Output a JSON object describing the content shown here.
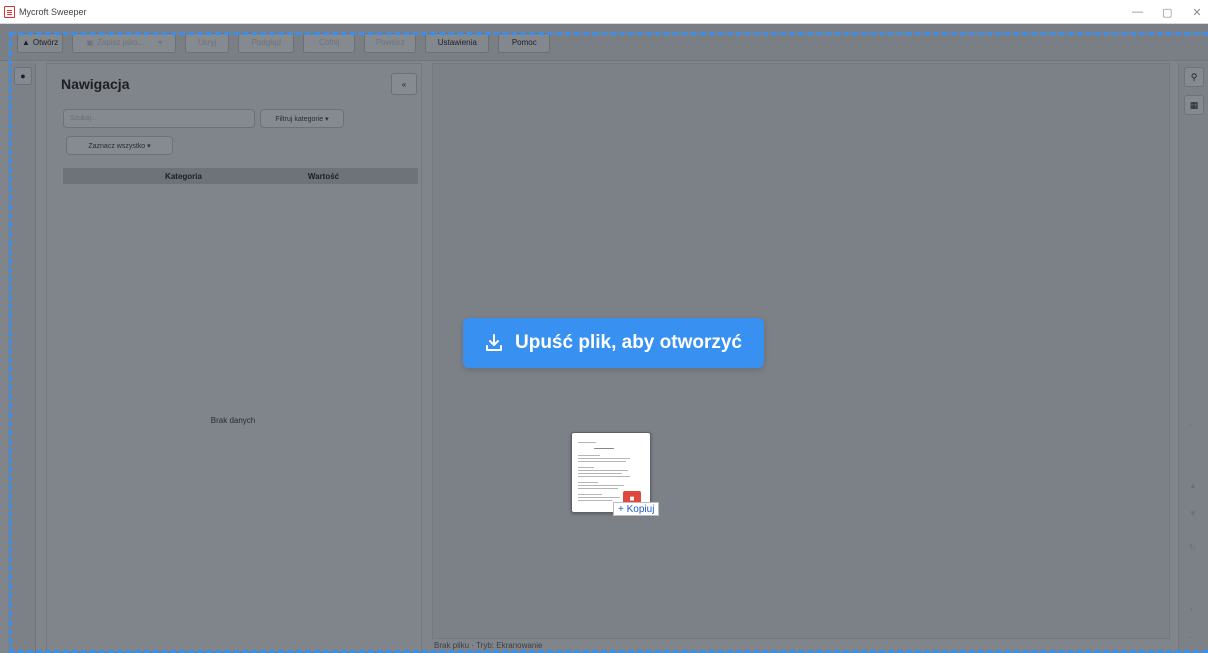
{
  "window": {
    "title": "Mycroft Sweeper",
    "controls": {
      "minimize": "—",
      "maximize": "▢",
      "close": "✕"
    }
  },
  "toolbar": {
    "open_label": "Otwórz",
    "save_as_label": "Zapisz jako...",
    "save_as_dropdown": "▾",
    "hide_label": "Ukryj",
    "preview_label": "Podgląd",
    "undo_label": "Cofnij",
    "redo_label": "Powtórz",
    "settings_label": "Ustawienia",
    "help_label": "Pomoc"
  },
  "nav": {
    "title": "Nawigacja",
    "collapse_icon": "«",
    "search_placeholder": "Szukaj...",
    "filter_label": "Filtruj kategorie ▾",
    "select_all_label": "Zaznacz wszystko ▾",
    "columns": [
      "Kategoria",
      "Wartość"
    ],
    "empty_message": "Brak danych"
  },
  "viewer": {
    "status_text": "Brak pliku · Tryb: Ekranowanie"
  },
  "drop": {
    "message": "Upuść plik, aby otworzyć",
    "copy_tooltip": "+ Kopiuj"
  },
  "colors": {
    "accent": "#3890f0",
    "dashed_outline": "#3b8fe8",
    "pdf_badge": "#e0483e",
    "overlay_background": "#80858b"
  },
  "icons": {
    "open": "folder-icon",
    "save_as": "save-icon",
    "pin": "pin-icon",
    "collapse": "double-chevron-left-icon",
    "search": "search-icon",
    "columns": "columns-icon",
    "drop": "download-tray-icon"
  }
}
